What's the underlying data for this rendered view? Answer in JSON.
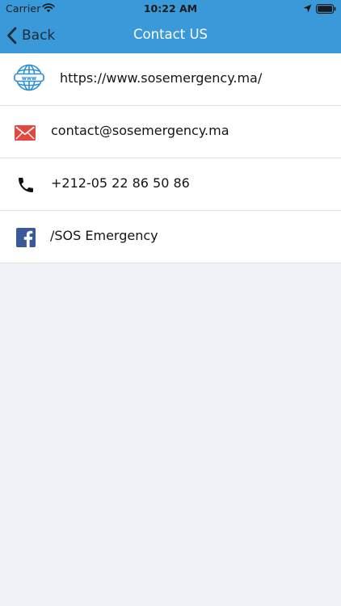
{
  "status_bar": {
    "carrier": "Carrier",
    "time": "10:22 AM"
  },
  "nav": {
    "back_label": "Back",
    "title": "Contact US"
  },
  "contacts": {
    "website": "https://www.sosemergency.ma/",
    "email": "contact@sosemergency.ma",
    "phone": "+212-05 22 86 50 86",
    "facebook": "/SOS Emergency"
  },
  "icons": {
    "website": "globe-www-icon",
    "email": "envelope-icon",
    "phone": "phone-icon",
    "facebook": "facebook-icon"
  },
  "colors": {
    "nav_bar": "#3a9ad9",
    "background": "#eff2f6",
    "globe": "#2a8fd6",
    "envelope": "#e2483d",
    "facebook": "#3b5998"
  }
}
